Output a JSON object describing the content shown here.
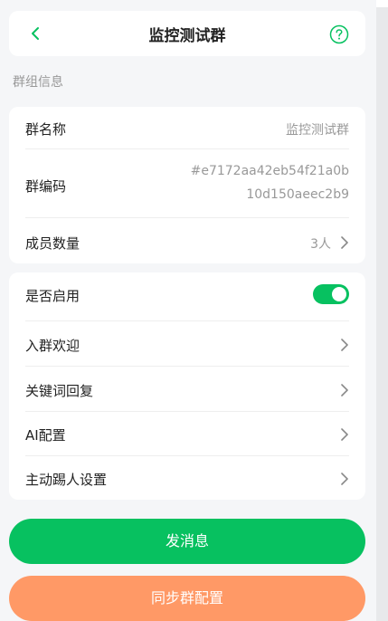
{
  "header": {
    "title": "监控测试群"
  },
  "section": {
    "group_info_label": "群组信息"
  },
  "group_info": {
    "name_label": "群名称",
    "name_value": "监控测试群",
    "code_label": "群编码",
    "code_value_line1": "#e7172aa42eb54f21a0b",
    "code_value_line2": "10d150aeec2b9",
    "members_label": "成员数量",
    "members_value": "3人"
  },
  "settings": {
    "enable_label": "是否启用",
    "enable_on": true,
    "welcome_label": "入群欢迎",
    "keyword_label": "关键词回复",
    "ai_label": "AI配置",
    "kick_label": "主动踢人设置"
  },
  "buttons": {
    "send_label": "发消息",
    "sync_label": "同步群配置"
  },
  "colors": {
    "accent_green": "#07c160",
    "sync_orange": "#ff9966"
  }
}
